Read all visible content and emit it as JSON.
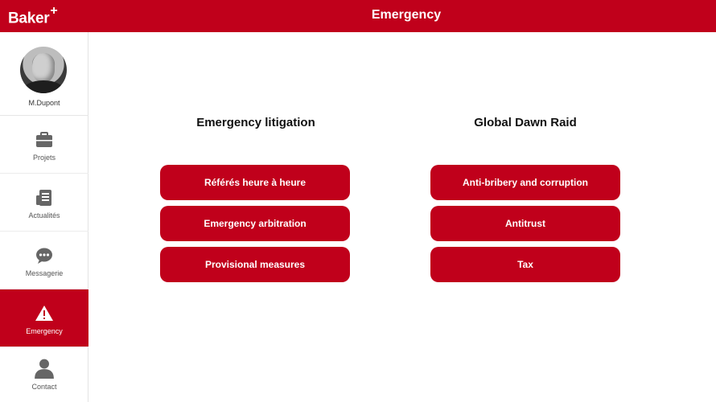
{
  "header": {
    "logo_text": "Baker",
    "logo_plus": "+",
    "title": "Emergency"
  },
  "profile": {
    "name": "M.Dupont"
  },
  "sidebar": {
    "items": [
      {
        "label": "Projets",
        "icon": "briefcase-icon"
      },
      {
        "label": "Actualités",
        "icon": "news-icon"
      },
      {
        "label": "Messagerie",
        "icon": "chat-bubble-icon"
      },
      {
        "label": "Emergency",
        "icon": "warning-icon",
        "active": true
      },
      {
        "label": "Contact",
        "icon": "person-icon"
      }
    ]
  },
  "main": {
    "sections": [
      {
        "title": "Emergency litigation",
        "buttons": [
          "Référés heure à heure",
          "Emergency arbitration",
          "Provisional measures"
        ]
      },
      {
        "title": "Global Dawn Raid",
        "buttons": [
          "Anti-bribery and corruption",
          "Antitrust",
          "Tax"
        ]
      }
    ]
  },
  "colors": {
    "brand_red": "#c0001b",
    "icon_gray": "#666666"
  }
}
